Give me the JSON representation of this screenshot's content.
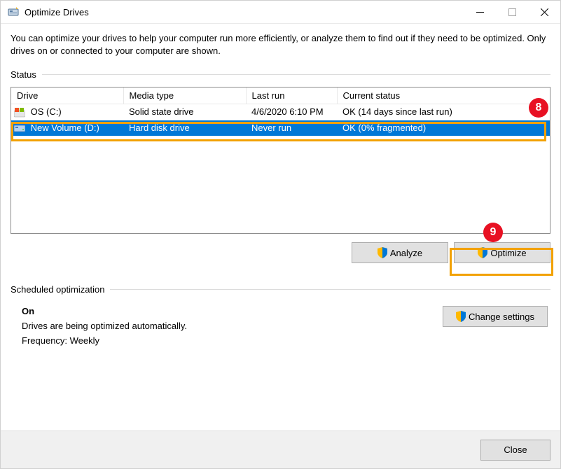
{
  "window": {
    "title": "Optimize Drives"
  },
  "intro": "You can optimize your drives to help your computer run more efficiently, or analyze them to find out if they need to be optimized. Only drives on or connected to your computer are shown.",
  "status": {
    "heading": "Status",
    "columns": {
      "drive": "Drive",
      "media_type": "Media type",
      "last_run": "Last run",
      "current_status": "Current status"
    },
    "rows": [
      {
        "drive": "OS (C:)",
        "media_type": "Solid state drive",
        "last_run": "4/6/2020 6:10 PM",
        "current_status": "OK (14 days since last run)",
        "selected": false,
        "icon": "windows"
      },
      {
        "drive": "New Volume (D:)",
        "media_type": "Hard disk drive",
        "last_run": "Never run",
        "current_status": "OK (0% fragmented)",
        "selected": true,
        "icon": "hdd"
      }
    ]
  },
  "buttons": {
    "analyze": "Analyze",
    "optimize": "Optimize",
    "change_settings": "Change settings",
    "close": "Close"
  },
  "scheduled": {
    "heading": "Scheduled optimization",
    "on_label": "On",
    "line1": "Drives are being optimized automatically.",
    "line2": "Frequency: Weekly"
  },
  "annotations": {
    "badge8": "8",
    "badge9": "9"
  }
}
